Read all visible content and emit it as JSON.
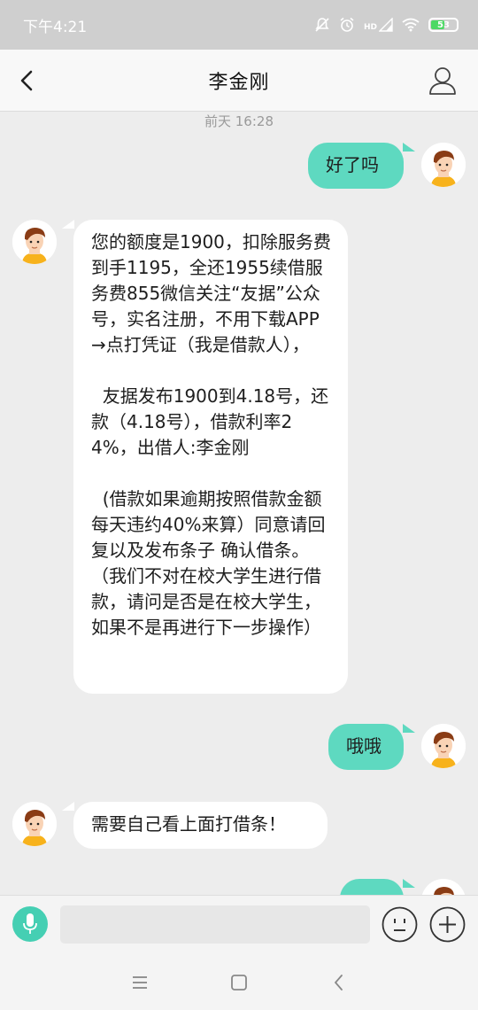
{
  "status_bar": {
    "time": "下午4:21",
    "network_label": "HD",
    "battery_level": "53",
    "battery_percent": 0.53,
    "icons": [
      "mute-icon",
      "alarm-icon",
      "signal-icon",
      "wifi-icon",
      "battery-icon"
    ]
  },
  "header": {
    "title": "李金刚",
    "back_icon": "chevron-left-icon",
    "profile_icon": "person-icon"
  },
  "chat": {
    "timestamp": "前天 16:28",
    "messages": [
      {
        "side": "right",
        "text": "好了吗"
      },
      {
        "side": "left",
        "text": "您的额度是1900，扣除服务费到手1195，全还1955续借服务费855微信关注“友据”公众号，实名注册，不用下载APP→点打凭证（我是借款人），\n\n  友据发布1900到4.18号，还款（4.18号），借款利率24%，出借人:李金刚\n\n  (借款如果逾期按照借款金额每天违约40%来算）同意请回复以及发布条子 确认借条。（我们不对在校大学生进行借款，请问是否是在校大学生，如果不是再进行下一步操作）"
      },
      {
        "side": "right",
        "text": "哦哦"
      },
      {
        "side": "left",
        "text": "需要自己看上面打借条！"
      },
      {
        "side": "right",
        "text": ""
      }
    ]
  },
  "input_bar": {
    "placeholder": "",
    "value": "",
    "icons": [
      "microphone-icon",
      "emoji-icon",
      "plus-icon"
    ]
  },
  "nav_bar": {
    "icons": [
      "menu-icon",
      "home-square-icon",
      "back-chevron-icon"
    ]
  },
  "colors": {
    "accent": "#45cfb3",
    "sent_bubble": "#5ed9c0",
    "received_bubble": "#ffffff",
    "background": "#ededed"
  }
}
